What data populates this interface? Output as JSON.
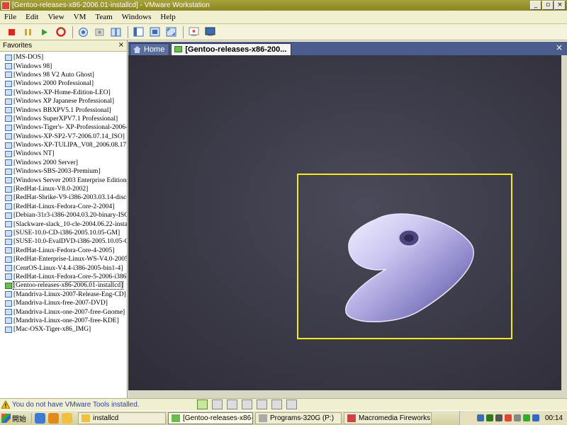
{
  "window": {
    "title": "[Gentoo-releases-x86-2006.01-installcd] - VMware Workstation",
    "controls": {
      "minimize": "_",
      "restore": "▫",
      "close": "×"
    }
  },
  "menu": [
    "File",
    "Edit",
    "View",
    "VM",
    "Team",
    "Windows",
    "Help"
  ],
  "toolbar": {
    "icons": [
      "power-off-icon",
      "suspend-icon",
      "power-on-icon",
      "reset-icon",
      "snapshot-icon",
      "revert-icon",
      "snapshot-manager-icon",
      "sidebar-toggle-icon",
      "quick-switch-icon",
      "full-screen-icon",
      "summary-view-icon",
      "console-view-icon"
    ]
  },
  "sidebar": {
    "title": "Favorites",
    "close": "×",
    "items": [
      "[MS-DOS]",
      "[Windows 98]",
      "[Windows 98 V2 Auto Ghost]",
      "[Windows 2000 Professional]",
      "[Windows-XP-Home-Edition-LEO]",
      "[Windows XP Japanese Professional]",
      "[Windows BBXPV5.1 Professional]",
      "[Windows SuperXPV7.1 Professional]",
      "[Windows-Tiger's- XP-Professional-2006-0",
      "[Windows-XP-SP2-V7-2006.07.14_ISO]",
      "[Windows-XP-TULIPA_V08_2006.08.17]",
      "[Windows NT]",
      "[Windows 2000 Server]",
      "[Windows-SBS-2003-Premium]",
      "[Windows Server 2003 Enterprise Edition]",
      "[RedHat-Linux-V8.0-2002]",
      "[RedHat-Shrike-V9-i386-2003.03.14-disc-",
      "[RedHat-Linux-Fedora-Core-2-2004]",
      "[Debian-31r3-i386-2004.03.20-binary-ISO",
      "[Slackware-slack_10-cle-2004.06.22-instal",
      "[SUSE-10.0-CD-i386-2005.10.05-GM]",
      "[SUSE-10.0-EvalDVD-i386-2005.10.05-G",
      "[RedHat-Linux-Fedora-Core-4-2005]",
      "[RedHat-Enterprise-Linux-WS-V4.0-2005-",
      "[CentOS-Linux-V4.4-i386-2005-bin1-4]",
      "[RedHat-Linux-Fedora-Core-5-2006-i386]",
      "[Gentoo-releases-x86-2006.01-installcd]",
      "[Mandriva-Linux-2007-Release-Eng-CD]",
      "[Mandriva-Linux-free-2007-DVD]",
      "[Mandriva-Linux-one-2007-free-Gnome]",
      "[Mandriva-Linux-one-2007-free-KDE]",
      "[Mac-OSX-Tiger-x86_IMG]"
    ],
    "selected_index": 26
  },
  "tabs": {
    "home_label": "Home",
    "active_label": "[Gentoo-releases-x86-200...",
    "close": "×"
  },
  "status": {
    "message": "You do not have VMware Tools installed."
  },
  "taskbar": {
    "start_label": "開始",
    "buttons": [
      {
        "label": "installcd",
        "active": false
      },
      {
        "label": "[Gentoo-releases-x86-2006...",
        "active": true
      },
      {
        "label": "Programs-320G (P:)",
        "active": false
      },
      {
        "label": "Macromedia Fireworks M...",
        "active": false
      }
    ],
    "clock": "00:14"
  }
}
